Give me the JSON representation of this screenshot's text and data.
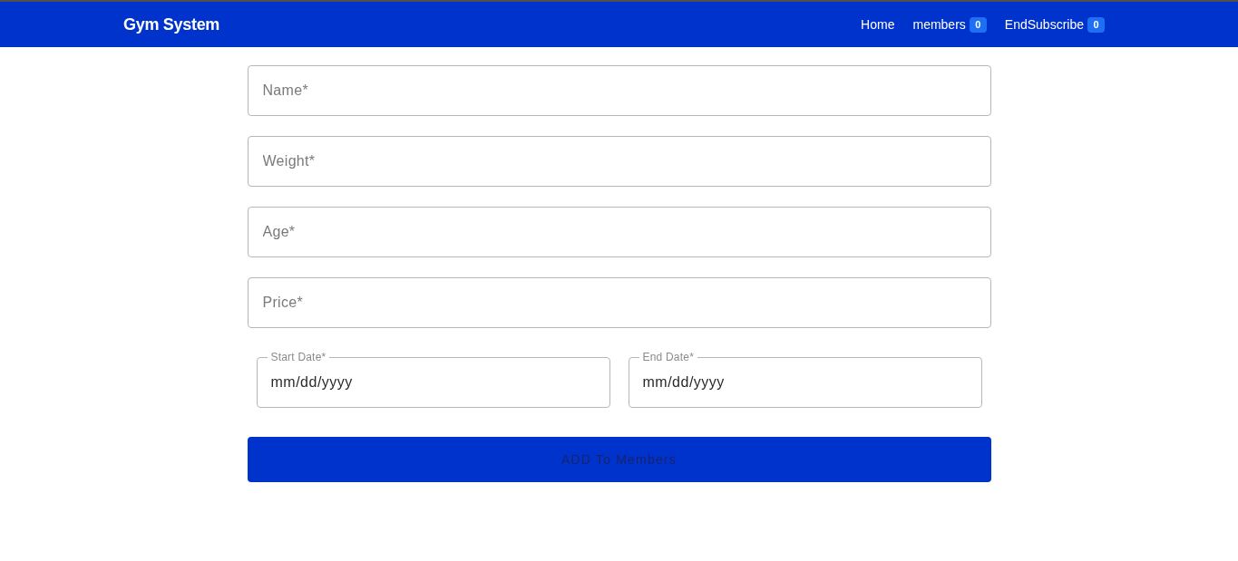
{
  "navbar": {
    "brand": "Gym System",
    "links": [
      {
        "label": "Home"
      },
      {
        "label": "members",
        "badge": "0"
      },
      {
        "label": "EndSubscribe",
        "badge": "0"
      }
    ]
  },
  "form": {
    "fields": [
      {
        "placeholder": "Name*"
      },
      {
        "placeholder": "Weight*"
      },
      {
        "placeholder": "Age*"
      },
      {
        "placeholder": "Price*"
      }
    ],
    "date_fields": [
      {
        "label": "Start Date*",
        "placeholder": "mm/dd/yyyy"
      },
      {
        "label": "End Date*",
        "placeholder": "mm/dd/yyyy"
      }
    ],
    "submit_button": "ADD To Members"
  }
}
